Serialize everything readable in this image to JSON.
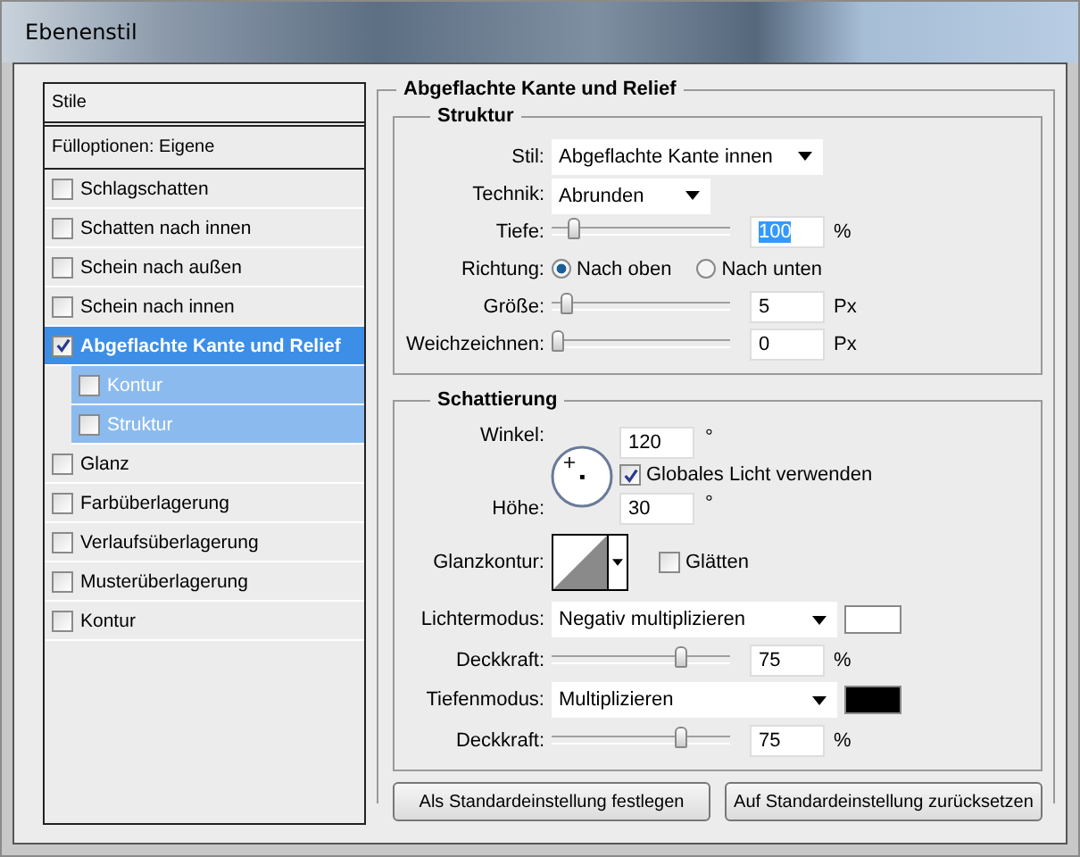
{
  "window": {
    "title": "Ebenenstil"
  },
  "styles_panel": {
    "header": "Stile",
    "blending_options": "Fülloptionen: Eigene",
    "items": [
      {
        "label": "Schlagschatten",
        "checked": false,
        "selected": false
      },
      {
        "label": "Schatten nach innen",
        "checked": false,
        "selected": false
      },
      {
        "label": "Schein nach außen",
        "checked": false,
        "selected": false
      },
      {
        "label": "Schein nach innen",
        "checked": false,
        "selected": false
      },
      {
        "label": "Abgeflachte Kante und Relief",
        "checked": true,
        "selected": true,
        "children": [
          {
            "label": "Kontur",
            "checked": false,
            "selected": false
          },
          {
            "label": "Struktur",
            "checked": false,
            "selected": false
          }
        ]
      },
      {
        "label": "Glanz",
        "checked": false,
        "selected": false
      },
      {
        "label": "Farbüberlagerung",
        "checked": false,
        "selected": false
      },
      {
        "label": "Verlaufsüberlagerung",
        "checked": false,
        "selected": false
      },
      {
        "label": "Musterüberlagerung",
        "checked": false,
        "selected": false
      },
      {
        "label": "Kontur",
        "checked": false,
        "selected": false
      }
    ]
  },
  "bevel": {
    "title": "Abgeflachte Kante und Relief",
    "structure": {
      "title": "Struktur",
      "rows": [
        {
          "kind": "dropdown",
          "label": "Stil:",
          "value": "Abgeflachte Kante innen"
        },
        {
          "kind": "dropdown",
          "label": "Technik:",
          "value": "Abrunden"
        },
        {
          "kind": "slider",
          "label": "Tiefe:",
          "level": 0.1,
          "value": "100",
          "value_highlighted": true,
          "unit": "%"
        },
        {
          "kind": "radio",
          "label": "Richtung:",
          "options": [
            {
              "label": "Nach oben",
              "selected": true
            },
            {
              "label": "Nach unten",
              "selected": false
            }
          ]
        },
        {
          "kind": "slider",
          "label": "Größe:",
          "level": 0.05,
          "value": "5",
          "unit": "Px"
        },
        {
          "kind": "slider",
          "label": "Weichzeichnen:",
          "level": 0,
          "value": "0",
          "unit": "Px"
        }
      ]
    },
    "shading": {
      "title": "Schattierung",
      "angle": {
        "label": "Winkel:",
        "value": "120",
        "unit": "°"
      },
      "global_light": {
        "label": "Globales Licht verwenden",
        "checked": true
      },
      "altitude": {
        "label": "Höhe:",
        "value": "30",
        "unit": "°"
      },
      "gloss_contour": {
        "label": "Glanzkontur:"
      },
      "anti_aliased": {
        "label": "Glätten",
        "checked": false
      },
      "rows": [
        {
          "kind": "mode",
          "label": "Lichtermodus:",
          "value": "Negativ multiplizieren",
          "color": "#ffffff"
        },
        {
          "kind": "slider",
          "label": "Deckkraft:",
          "level": 0.75,
          "value": "75",
          "unit": "%"
        },
        {
          "kind": "mode",
          "label": "Tiefenmodus:",
          "value": "Multiplizieren",
          "color": "#000000"
        },
        {
          "kind": "slider",
          "label": "Deckkraft:",
          "level": 0.75,
          "value": "75",
          "unit": "%"
        }
      ]
    }
  },
  "buttons": [
    "Als Standardeinstellung festlegen",
    "Auf Standardeinstellung zurücksetzen"
  ]
}
